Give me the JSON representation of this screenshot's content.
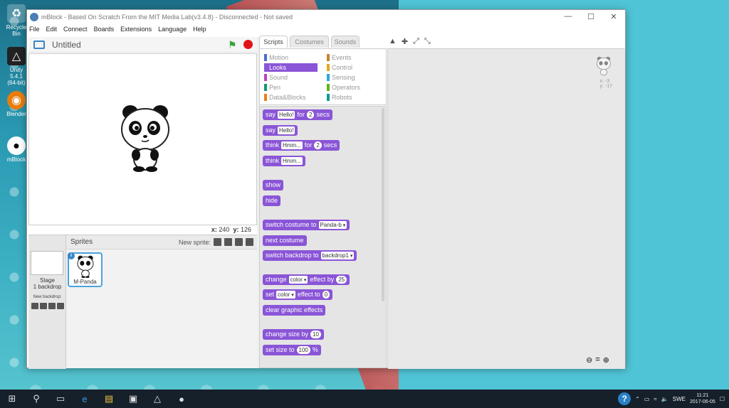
{
  "window": {
    "title": "mBlock - Based On Scratch From the MIT Media Lab(v3.4.8) - Disconnected - Not saved",
    "controls": [
      "—",
      "☐",
      "✕"
    ]
  },
  "menu": [
    "File",
    "Edit",
    "Connect",
    "Boards",
    "Extensions",
    "Language",
    "Help"
  ],
  "stage": {
    "project_title": "Untitled",
    "coords": {
      "x_label": "x:",
      "x": "240",
      "y_label": "y:",
      "y": "126"
    }
  },
  "sprites": {
    "header": "Sprites",
    "new_sprite_label": "New sprite:",
    "stage_label": "Stage",
    "stage_backdrops": "1 backdrop",
    "new_backdrop_label": "New backdrop:",
    "sprite_name": "M-Panda"
  },
  "tabs": [
    "Scripts",
    "Costumes",
    "Sounds"
  ],
  "categories": {
    "left": [
      {
        "label": "Motion",
        "color": "#4a6cd4"
      },
      {
        "label": "Looks",
        "color": "#8a55d7"
      },
      {
        "label": "Sound",
        "color": "#bb42c3"
      },
      {
        "label": "Pen",
        "color": "#0e9a6c"
      },
      {
        "label": "Data&Blocks",
        "color": "#ee7d16"
      }
    ],
    "right": [
      {
        "label": "Events",
        "color": "#c88330"
      },
      {
        "label": "Control",
        "color": "#e1a91a"
      },
      {
        "label": "Sensing",
        "color": "#2ca5e2"
      },
      {
        "label": "Operators",
        "color": "#5cb712"
      },
      {
        "label": "Robots",
        "color": "#0e9a9a"
      }
    ],
    "selected": "Looks"
  },
  "blocks": {
    "say_for": {
      "a": "say",
      "v1": "Hello!",
      "b": "for",
      "v2": "2",
      "c": "secs"
    },
    "say": {
      "a": "say",
      "v1": "Hello!"
    },
    "think_for": {
      "a": "think",
      "v1": "Hmm...",
      "b": "for",
      "v2": "2",
      "c": "secs"
    },
    "think": {
      "a": "think",
      "v1": "Hmm..."
    },
    "show": "show",
    "hide": "hide",
    "switch_costume": {
      "a": "switch costume to",
      "v1": "Panda-b"
    },
    "next_costume": "next costume",
    "switch_backdrop": {
      "a": "switch backdrop to",
      "v1": "backdrop1"
    },
    "change_effect": {
      "a": "change",
      "v1": "color",
      "b": "effect by",
      "v2": "25"
    },
    "set_effect": {
      "a": "set",
      "v1": "color",
      "b": "effect to",
      "v2": "0"
    },
    "clear_effects": "clear graphic effects",
    "change_size": {
      "a": "change size by",
      "v1": "10"
    },
    "set_size": {
      "a": "set size to",
      "v1": "100",
      "b": "%"
    }
  },
  "script_area": {
    "coords_x": "x: -3",
    "coords_y": "y: -17"
  },
  "desktop": {
    "icons": [
      "Recycle Bin",
      "Unity 5.4.1 (64-bit)",
      "Blender",
      "mBlock"
    ]
  },
  "taskbar": {
    "lang": "SWE",
    "time": "11:21",
    "date": "2017-06-05"
  }
}
